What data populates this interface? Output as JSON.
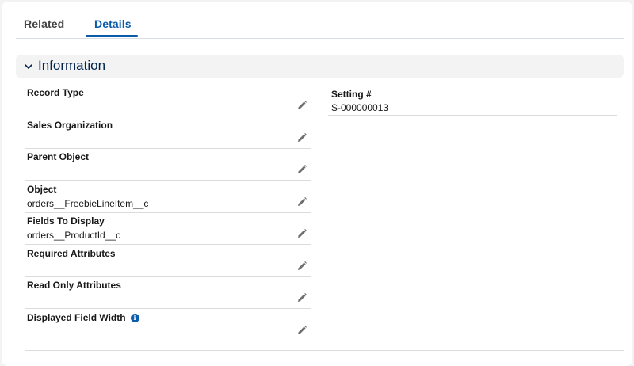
{
  "tabs": [
    {
      "label": "Related"
    },
    {
      "label": "Details"
    }
  ],
  "section": {
    "title": "Information"
  },
  "fields_left": [
    {
      "label": "Record Type",
      "value": ""
    },
    {
      "label": "Sales Organization",
      "value": ""
    },
    {
      "label": "Parent Object",
      "value": ""
    },
    {
      "label": "Object",
      "value": "orders__FreebieLineItem__c"
    },
    {
      "label": "Fields To Display",
      "value": "orders__ProductId__c"
    },
    {
      "label": "Required Attributes",
      "value": ""
    },
    {
      "label": "Read Only Attributes",
      "value": ""
    },
    {
      "label": "Displayed Field Width",
      "value": "",
      "info_icon": "info-icon"
    }
  ],
  "fields_right": [
    {
      "label": "Setting #",
      "value": "S-000000013"
    }
  ],
  "colors": {
    "accent": "#0b5cab",
    "section_title": "#03234d",
    "section_bg": "#f3f3f3"
  },
  "icons": {
    "edit": "pencil-icon",
    "chevron": "chevron-down-icon",
    "info": "info-icon"
  }
}
